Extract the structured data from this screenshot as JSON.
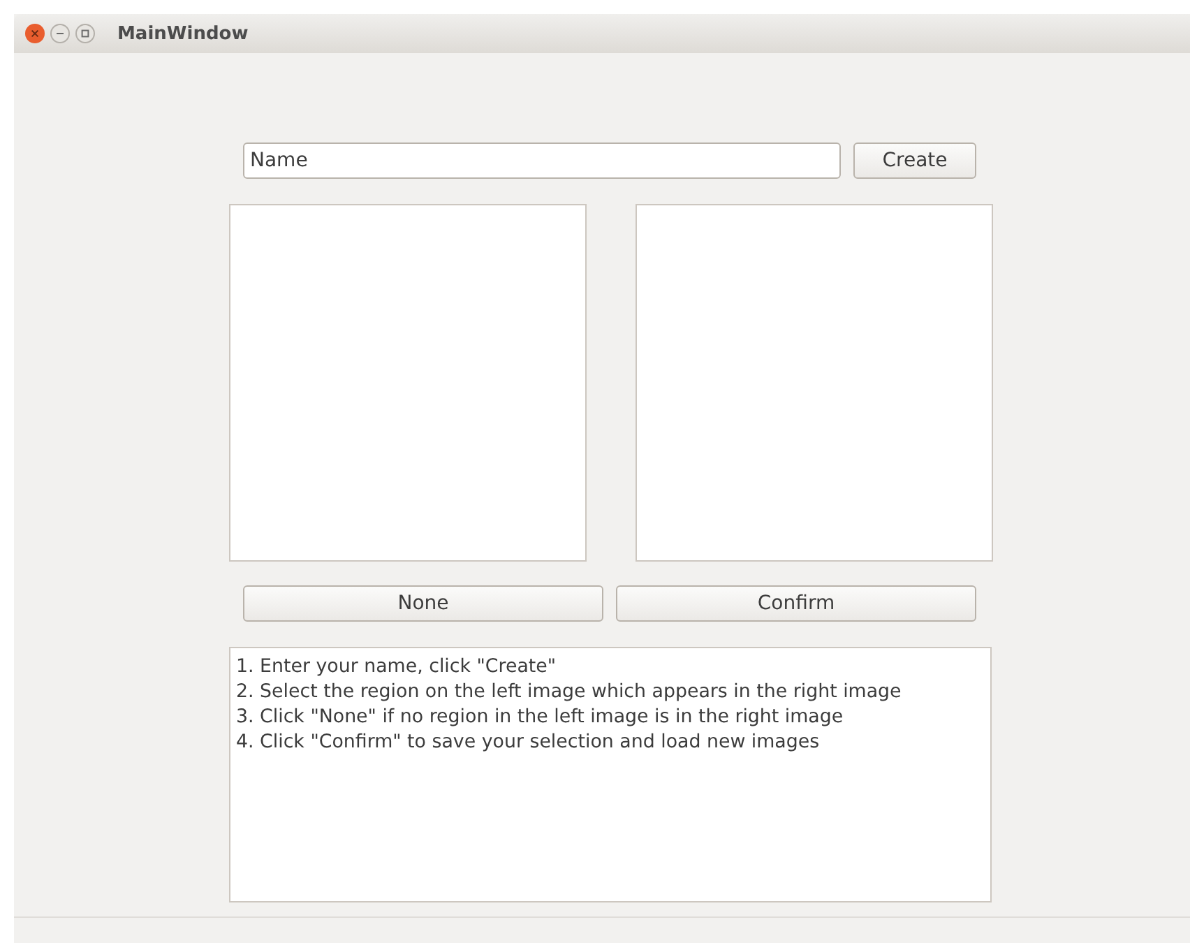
{
  "window": {
    "title": "MainWindow"
  },
  "name_field": {
    "value": "Name"
  },
  "create_button": "Create",
  "buttons": [
    "None",
    "Confirm"
  ],
  "instructions": [
    "1. Enter your name, click \"Create\"",
    "2. Select the region on the left image which appears in the right image",
    "3. Click \"None\" if no region in the left image is in the right image",
    "4. Click \"Confirm\" to save your selection and load new images"
  ]
}
